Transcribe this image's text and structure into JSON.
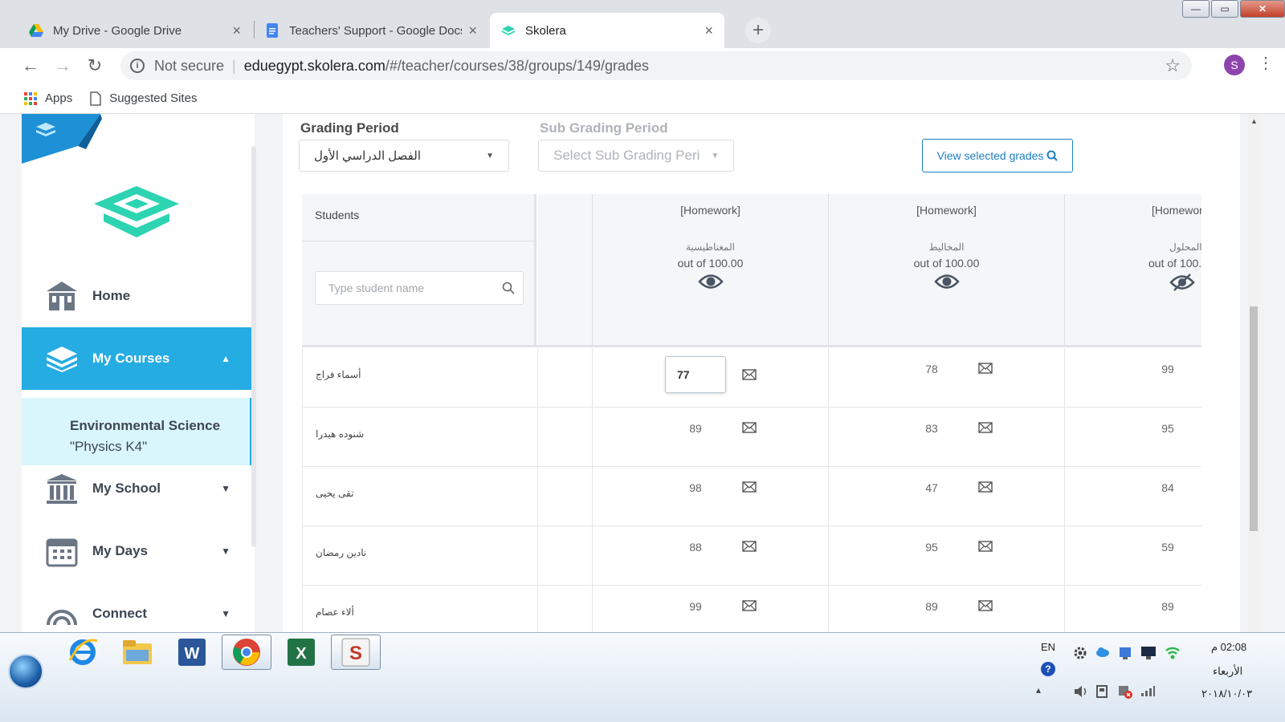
{
  "browser": {
    "tabs": [
      {
        "title": "My Drive - Google Drive",
        "icon": "google-drive-icon"
      },
      {
        "title": "Teachers' Support - Google Docs",
        "icon": "google-docs-icon"
      },
      {
        "title": "Skolera",
        "icon": "skolera-icon"
      }
    ],
    "close_glyph": "×",
    "new_tab_glyph": "+",
    "window_controls": {
      "minimize": "—",
      "maximize": "▭",
      "close": "✕"
    },
    "address": {
      "security_label": "Not secure",
      "divider": "|",
      "host": "eduegypt.skolera.com",
      "path": "/#/teacher/courses/38/groups/149/grades"
    },
    "profile_initial": "S",
    "menu_glyph": "⋮",
    "bookmarks": [
      {
        "label": "Apps",
        "icon": "apps-grid-icon"
      },
      {
        "label": "Suggested Sites",
        "icon": "page-icon"
      }
    ]
  },
  "sidebar": {
    "nav": [
      {
        "label": "Home",
        "icon": "home-building-icon",
        "caret": ""
      },
      {
        "label": "My Courses",
        "icon": "courses-stack-icon",
        "caret": "▲"
      },
      {
        "label": "My School",
        "icon": "school-columns-icon",
        "caret": "▼"
      },
      {
        "label": "My Days",
        "icon": "calendar-icon",
        "caret": "▼"
      },
      {
        "label": "Connect",
        "icon": "connect-icon",
        "caret": "▼"
      }
    ],
    "course": {
      "line1": "Environmental Science",
      "line2": "\"Physics K4\""
    }
  },
  "filters": {
    "grading_period_label": "Grading Period",
    "grading_period_value": "الفصل الدراسي الأول",
    "sub_period_label": "Sub Grading Period",
    "sub_period_placeholder": "Select Sub Grading Peri",
    "view_button": "View selected grades"
  },
  "grades": {
    "students_header": "Students",
    "search_placeholder": "Type student name",
    "columns": [
      {
        "type": "[Homework]",
        "name": "المغناطيسية",
        "out_of": "out of 100.00",
        "visibility": "visible"
      },
      {
        "type": "[Homework]",
        "name": "المخاليط",
        "out_of": "out of 100.00",
        "visibility": "visible"
      },
      {
        "type": "[Homewor",
        "name": "المحلول",
        "out_of": "out of 100.",
        "visibility": "hidden"
      }
    ],
    "rows": [
      {
        "student": "أسماء فراج",
        "grades": [
          "77",
          "78",
          "99"
        ]
      },
      {
        "student": "شنوده هيدرا",
        "grades": [
          "89",
          "83",
          "95"
        ]
      },
      {
        "student": "تقى يحيى",
        "grades": [
          "98",
          "47",
          "84"
        ]
      },
      {
        "student": "نادين رمضان",
        "grades": [
          "88",
          "95",
          "59"
        ]
      },
      {
        "student": "ألاء عصام",
        "grades": [
          "99",
          "89",
          "89"
        ]
      }
    ]
  },
  "taskbar": {
    "apps": [
      "internet-explorer-icon",
      "file-explorer-icon",
      "word-icon",
      "chrome-icon",
      "excel-icon",
      "skolera-app-icon"
    ],
    "lang": "EN",
    "time": "02:08 م",
    "day": "الأربعاء",
    "date": "٢٠١٨/١٠/٠٣"
  },
  "colors": {
    "accent": "#25ace3",
    "brand_teal": "#2dd4b2",
    "button_blue": "#1d7fc4",
    "submenu_bg": "#d9f6fc"
  }
}
